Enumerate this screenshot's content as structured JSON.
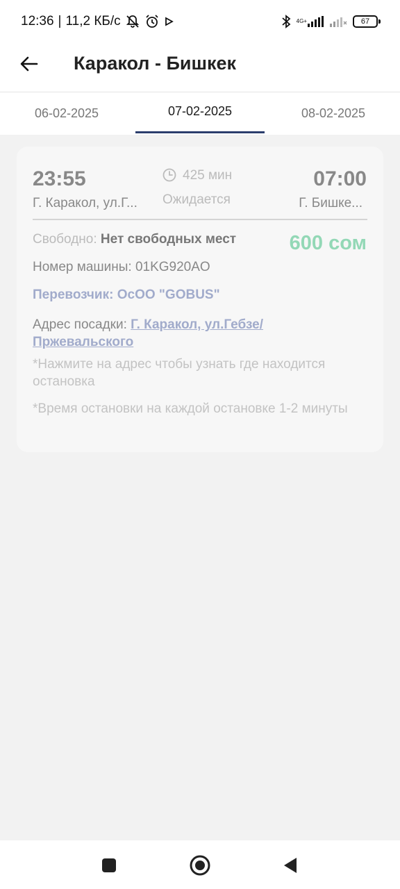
{
  "status_bar": {
    "time": "12:36",
    "separator": "|",
    "speed": "11,2 КБ/с",
    "network_label": "4G+",
    "battery": "67"
  },
  "header": {
    "title": "Каракол - Бишкек"
  },
  "tabs": [
    {
      "label": "06-02-2025",
      "active": false
    },
    {
      "label": "07-02-2025",
      "active": true
    },
    {
      "label": "08-02-2025",
      "active": false
    }
  ],
  "trip": {
    "departure_time": "23:55",
    "departure_city": "Г. Каракол, ул.Г...",
    "duration": "425 мин",
    "status": "Ожидается",
    "arrival_time": "07:00",
    "arrival_city": "Г. Бишке...",
    "free_label": "Свободно:",
    "free_value": "Нет свободных мест",
    "price": "600 сом",
    "car_number": "Номер машины: 01KG920AO",
    "carrier": "Перевозчик: ОсОО \"GOBUS\"",
    "address_label": "Адрес посадки:",
    "address_value": "Г. Каракол, ул.Гебзе/ Пржевальского",
    "note_address": "*Нажмите на адрес чтобы узнать где находится остановка",
    "note_stop": "*Время остановки на каждой остановке 1-2 минуты"
  },
  "colors": {
    "tab_indicator": "#2c3e6d",
    "price": "#93d8b6",
    "link": "#a1abcb"
  }
}
